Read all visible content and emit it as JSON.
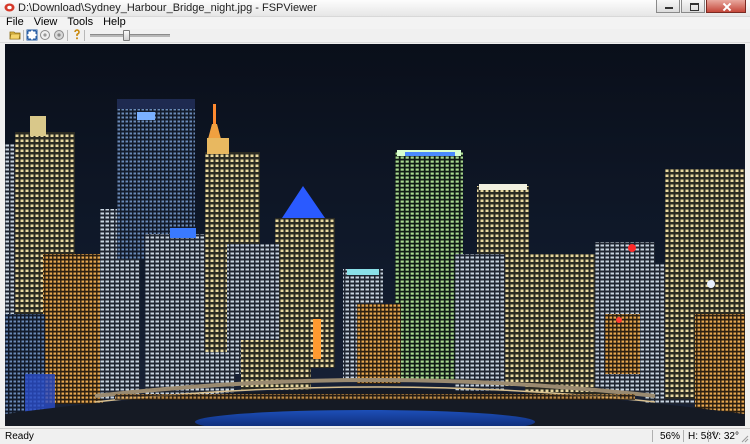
{
  "window": {
    "title": "D:\\Download\\Sydney_Harbour_Bridge_night.jpg - FSPViewer"
  },
  "menu": {
    "items": [
      "File",
      "View",
      "Tools",
      "Help"
    ]
  },
  "toolbar": {
    "zoom_slider_level": 0.45
  },
  "status": {
    "text": "Ready",
    "zoom": "56%",
    "heading": "H: 58°",
    "vertical": "V: 32°"
  },
  "colors": {
    "accent_close": "#c4473a",
    "sky": "#0b111d"
  }
}
